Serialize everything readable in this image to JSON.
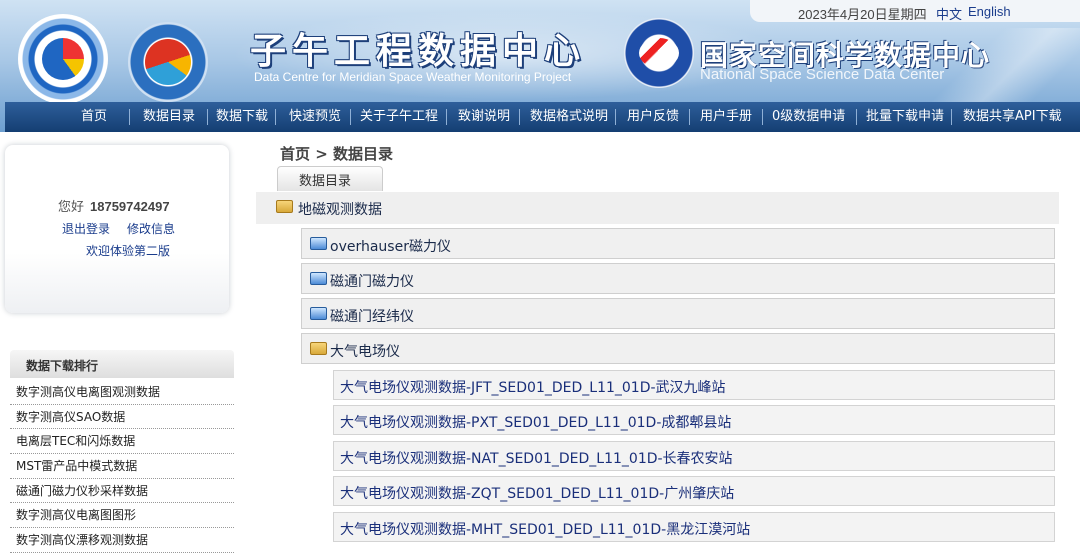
{
  "header": {
    "date": "2023年4月20日星期四",
    "lang_zh": "中文",
    "lang_en": "English",
    "title_cn": "子午工程数据中心",
    "title_en": "Data Centre for Meridian Space Weather Monitoring Project",
    "nssdc_cn": "国家空间科学数据中心",
    "nssdc_en": "National Space Science Data Center"
  },
  "nav": {
    "items": [
      "首页",
      "数据目录",
      "数据下载",
      "快速预览",
      "关于子午工程",
      "致谢说明",
      "数据格式说明",
      "用户反馈",
      "用户手册",
      "0级数据申请",
      "批量下载申请",
      "数据共享API下载"
    ]
  },
  "user": {
    "greeting": "您好",
    "phone": "18759742497",
    "logout": "退出登录",
    "edit_info": "修改信息",
    "welcome": "欢迎体验第二版"
  },
  "ranking": {
    "title": "数据下载排行",
    "items": [
      "数字测高仪电离图观测数据",
      "数字测高仪SAO数据",
      "电离层TEC和闪烁数据",
      "MST雷产品中模式数据",
      "磁通门磁力仪秒采样数据",
      "数字测高仪电离图图形",
      "数字测高仪漂移观测数据"
    ]
  },
  "main": {
    "breadcrumb": "首页 > 数据目录",
    "tab": "数据目录",
    "root": "地磁观测数据",
    "children": [
      "overhauser磁力仪",
      "磁通门磁力仪",
      "磁通门经纬仪",
      "大气电场仪"
    ],
    "leaves": [
      "大气电场仪观测数据-JFT_SED01_DED_L11_01D-武汉九峰站",
      "大气电场仪观测数据-PXT_SED01_DED_L11_01D-成都郫县站",
      "大气电场仪观测数据-NAT_SED01_DED_L11_01D-长春农安站",
      "大气电场仪观测数据-ZQT_SED01_DED_L11_01D-广州肇庆站",
      "大气电场仪观测数据-MHT_SED01_DED_L11_01D-黑龙江漠河站"
    ]
  },
  "colors": {
    "nav_bg": "#1f4c85",
    "link": "#1a3c8c",
    "folder_open": "#e6b84a",
    "folder_closed": "#4c8bd6"
  }
}
